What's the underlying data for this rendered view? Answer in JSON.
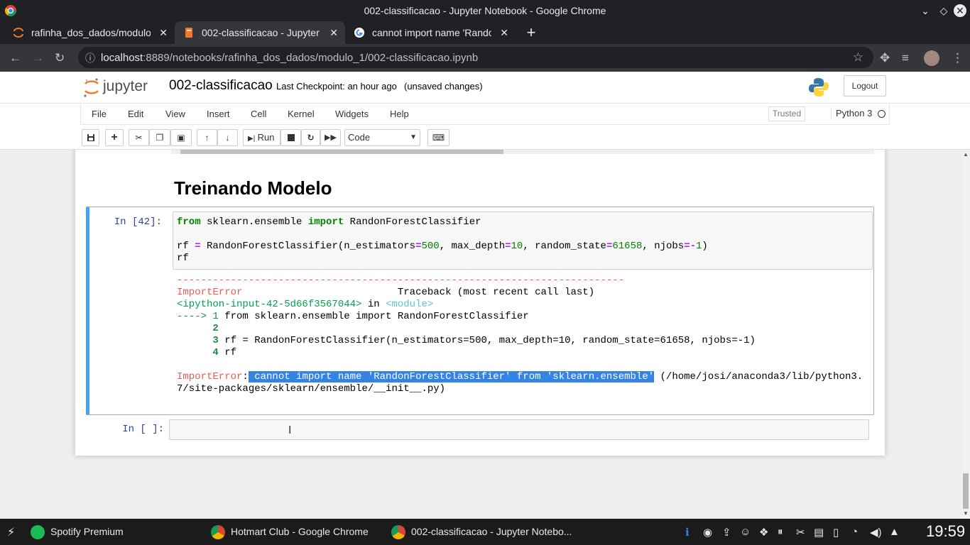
{
  "window": {
    "title": "002-classificacao - Jupyter Notebook - Google Chrome"
  },
  "tabs": [
    {
      "label": "rafinha_dos_dados/modulo_",
      "close": "✕"
    },
    {
      "label": "002-classificacao - Jupyter No",
      "close": "✕"
    },
    {
      "label": "cannot import name 'Randon",
      "close": "✕"
    }
  ],
  "new_tab": "+",
  "address": {
    "host": "localhost",
    "rest": ":8889/notebooks/rafinha_dos_dados/modulo_1/002-classificacao.ipynb"
  },
  "jupyter": {
    "logo_text": "jupyter",
    "notebook_name": "002-classificacao",
    "checkpoint": "Last Checkpoint: an hour ago",
    "unsaved": "(unsaved changes)",
    "logout": "Logout"
  },
  "menu": {
    "items": [
      "File",
      "Edit",
      "View",
      "Insert",
      "Cell",
      "Kernel",
      "Widgets",
      "Help"
    ],
    "trusted": "Trusted",
    "kernel": "Python 3"
  },
  "toolbar": {
    "run_label": "Run",
    "cell_type": "Code"
  },
  "notebook": {
    "heading": "Treinando Modelo",
    "cell1_prompt": "In [42]:",
    "code_line1": {
      "k1": "from",
      "mod": " sklearn.ensemble ",
      "k2": "import",
      "name": " RandonForestClassifier"
    },
    "code_line3": {
      "a": "rf ",
      "eq": "=",
      "b": " RandonForestClassifier(n_estimators",
      "eq2": "=",
      "n1": "500",
      "c": ", max_depth",
      "eq3": "=",
      "n2": "10",
      "d": ", random_state",
      "eq4": "=",
      "n3": "61658",
      "e": ", njobs",
      "eq5": "=-",
      "n4": "1",
      "f": ")"
    },
    "code_line4": "rf",
    "tb_dashes": "---------------------------------------------------------------------------",
    "tb_error": "ImportError",
    "tb_header": "Traceback (most recent call last)",
    "tb_input": "<ipython-input-42-5d66f3567044>",
    "tb_in": " in ",
    "tb_module": "<module>",
    "tb_arrow": "----> 1",
    "tb_l1": " from sklearn.ensemble import RandonForestClassifier",
    "tb_n2": "      2",
    "tb_n3": "      3",
    "tb_l3": " rf = RandonForestClassifier(n_estimators=500, max_depth=10, random_state=61658, njobs=-1)",
    "tb_n4": "      4",
    "tb_l4": " rf",
    "err_label": "ImportError",
    "err_colon": ":",
    "err_selected": " cannot import name 'RandonForestClassifier' from 'sklearn.ensemble'",
    "err_path1": " (/home/josi/anaconda3/lib/python3.",
    "err_path2": "7/site-packages/sklearn/ensemble/__init__.py)",
    "cell2_prompt": "In [ ]:"
  },
  "taskbar": {
    "items": [
      "Spotify Premium",
      "Hotmart Club - Google Chrome",
      "002-classificacao - Jupyter Notebo..."
    ],
    "clock": "19:59"
  },
  "colors": {
    "cell_selected_border": "#42a5f5",
    "prompt": "#303f9f",
    "error_red": "#e75c58",
    "selection": "#3584e4"
  }
}
